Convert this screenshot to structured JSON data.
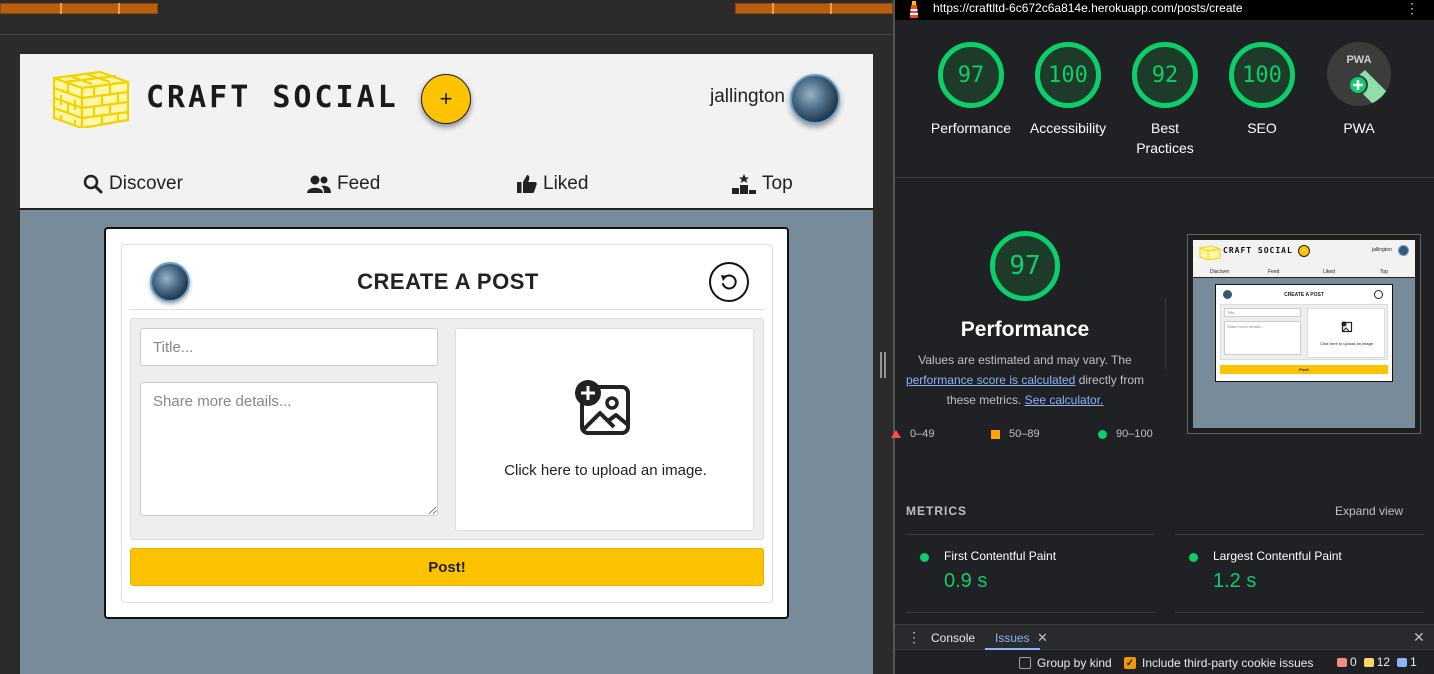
{
  "app": {
    "brand": "CRAFT SOCIAL",
    "add_label": "+",
    "username": "jallington",
    "nav": [
      {
        "label": "Discover"
      },
      {
        "label": "Feed"
      },
      {
        "label": "Liked"
      },
      {
        "label": "Top"
      }
    ],
    "create_post": {
      "title": "CREATE A POST",
      "title_placeholder": "Title...",
      "details_placeholder": "Share more details...",
      "upload_text": "Click here to upload an image.",
      "post_label": "Post!"
    },
    "colors": {
      "accent": "#fdc300",
      "page_bg": "#778b9a",
      "nav_bg": "#f2f2f2"
    }
  },
  "lighthouse": {
    "url": "https://craftltd-6c672c6a814e.herokuapp.com/posts/create",
    "scores": [
      {
        "value": "97",
        "label": "Performance"
      },
      {
        "value": "100",
        "label": "Accessibility"
      },
      {
        "value": "92",
        "label": "Best Practices"
      },
      {
        "value": "100",
        "label": "SEO"
      }
    ],
    "pwa_badge": "PWA",
    "pwa_label": "PWA",
    "perf_score": "97",
    "perf_title": "Performance",
    "perf_desc_1": "Values are estimated and may vary. The",
    "perf_link_1": "performance score is calculated",
    "perf_desc_2": "directly from these metrics.",
    "perf_link_2": "See calculator.",
    "legend": [
      {
        "range": "0–49",
        "color": "#ff4e42"
      },
      {
        "range": "50–89",
        "color": "#ffa400"
      },
      {
        "range": "90–100",
        "color": "#0cce6b"
      }
    ],
    "thumbnail": {
      "brand": "CRAFT SOCIAL",
      "username": "jallington",
      "nav": [
        "Discover",
        "Feed",
        "Liked",
        "Top"
      ],
      "card_title": "CREATE A POST",
      "title_ph": "Title...",
      "details_ph": "Share more details...",
      "upload_text": "Click here to upload an image.",
      "post_label": "Post!"
    },
    "metrics_heading": "METRICS",
    "expand_label": "Expand view",
    "metrics": [
      {
        "label": "First Contentful Paint",
        "value": "0.9 s"
      },
      {
        "label": "Largest Contentful Paint",
        "value": "1.2 s"
      }
    ],
    "score_color": "#0cce6b"
  },
  "drawer": {
    "tabs": [
      {
        "label": "Console"
      },
      {
        "label": "Issues"
      }
    ],
    "group_by_kind": "Group by kind",
    "include_third_party": "Include third-party cookie issues",
    "counts": {
      "errors": "0",
      "warnings": "12",
      "info": "1"
    }
  }
}
